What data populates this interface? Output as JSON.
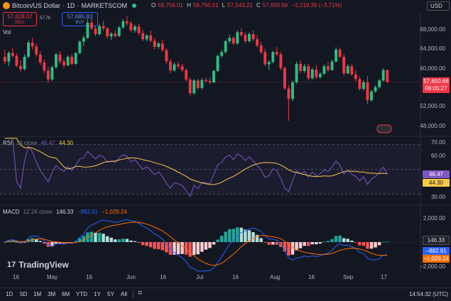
{
  "header": {
    "symbol": "Bitcoin/US Dollar",
    "interval": "1D",
    "exchange": "MARKETSCOM",
    "ohlc": [
      {
        "label": "O",
        "value": "59,756.01"
      },
      {
        "label": "H",
        "value": "59,756.01"
      },
      {
        "label": "L",
        "value": "57,543.21"
      },
      {
        "label": "C",
        "value": "57,650.66"
      }
    ],
    "change": "−2,219.39 (−3.71%)",
    "currency": "USD"
  },
  "trade": {
    "sell_price": "57,628.07",
    "sell_label": "SELL",
    "spread": "57.76",
    "buy_price": "57,685.83",
    "buy_label": "BUY"
  },
  "volume_label": "Vol",
  "price_axis": {
    "ticks": [
      "68,000.00",
      "64,000.00",
      "60,000.00",
      "56,000.00",
      "52,000.00",
      "48,000.00"
    ],
    "last_price": "57,650.66",
    "countdown": "06:05:27"
  },
  "rsi": {
    "name": "RSI",
    "params": "14 close",
    "rsi_value": "46.47",
    "ma_value": "44.30",
    "ticks": [
      "70.00",
      "60.00",
      "50.00",
      "40.00",
      "30.00"
    ]
  },
  "macd": {
    "name": "MACD",
    "params": "12 26 close",
    "hist_value": "146.33",
    "macd_value": "−882.91",
    "signal_value": "−1,029.24",
    "ticks": [
      "2,000.00",
      "0.00",
      "−2,000.00"
    ]
  },
  "time_axis": [
    "16",
    "May",
    "16",
    "Jun",
    "16",
    "Jul",
    "16",
    "Aug",
    "16",
    "Sep",
    "17"
  ],
  "timeframes": [
    "1D",
    "5D",
    "1M",
    "3M",
    "6M",
    "YTD",
    "1Y",
    "5Y",
    "All"
  ],
  "clock": "14:54:32 (UTC)",
  "brand": "TradingView",
  "colors": {
    "bg": "#131722",
    "up": "#2ebd85",
    "down": "#f23645",
    "rsi_line": "#7e57c2",
    "rsi_ma": "#f7c948",
    "macd_line": "#2962ff",
    "signal_line": "#ff6d00"
  },
  "chart_data": {
    "type": "candlestick",
    "price_range": [
      46500,
      72000
    ],
    "candles": [
      [
        63000,
        64500,
        61500,
        62000
      ],
      [
        62000,
        64200,
        61000,
        63800
      ],
      [
        63800,
        64800,
        62800,
        63200
      ],
      [
        63200,
        63700,
        60800,
        61100
      ],
      [
        61100,
        62300,
        59800,
        60400
      ],
      [
        60400,
        63500,
        60100,
        63000
      ],
      [
        63000,
        66500,
        62700,
        66000
      ],
      [
        66000,
        67000,
        64500,
        65200
      ],
      [
        65200,
        65800,
        63000,
        63500
      ],
      [
        63500,
        64200,
        61200,
        61800
      ],
      [
        61800,
        62500,
        59500,
        60100
      ],
      [
        60100,
        61000,
        57500,
        58200
      ],
      [
        58200,
        61200,
        57900,
        60800
      ],
      [
        60800,
        63800,
        60500,
        63500
      ],
      [
        63500,
        64200,
        61500,
        62000
      ],
      [
        62000,
        62600,
        60500,
        61200
      ],
      [
        61200,
        63300,
        61000,
        63000
      ],
      [
        63000,
        63600,
        61200,
        61500
      ],
      [
        61500,
        64000,
        61300,
        63800
      ],
      [
        63800,
        66500,
        63500,
        66200
      ],
      [
        66200,
        67500,
        65300,
        67000
      ],
      [
        67000,
        71000,
        66800,
        70200
      ],
      [
        70200,
        71200,
        68500,
        69000
      ],
      [
        69000,
        69600,
        67300,
        67800
      ],
      [
        67800,
        70000,
        67500,
        69500
      ],
      [
        69500,
        70600,
        68500,
        69000
      ],
      [
        69000,
        69300,
        66800,
        67300
      ],
      [
        67300,
        68200,
        66500,
        67900
      ],
      [
        67900,
        68500,
        67000,
        67400
      ],
      [
        67400,
        69500,
        67200,
        69200
      ],
      [
        69200,
        71000,
        68900,
        70500
      ],
      [
        70500,
        71600,
        69500,
        70100
      ],
      [
        70100,
        70500,
        68200,
        68600
      ],
      [
        68600,
        69800,
        68100,
        69400
      ],
      [
        69400,
        70000,
        67500,
        68000
      ],
      [
        68000,
        68700,
        66300,
        66700
      ],
      [
        66700,
        67800,
        66200,
        67500
      ],
      [
        67500,
        68500,
        66000,
        66400
      ],
      [
        66400,
        67000,
        64500,
        65100
      ],
      [
        65100,
        66100,
        64700,
        65800
      ],
      [
        65800,
        66600,
        64100,
        64400
      ],
      [
        64400,
        64800,
        61500,
        62000
      ],
      [
        62000,
        62500,
        59500,
        60100
      ],
      [
        60100,
        61800,
        59900,
        61400
      ],
      [
        61400,
        62000,
        60500,
        61000
      ],
      [
        61000,
        61500,
        59800,
        60200
      ],
      [
        60200,
        60600,
        57700,
        58200
      ],
      [
        58200,
        58700,
        54800,
        55300
      ],
      [
        55300,
        58300,
        55000,
        58000
      ],
      [
        58000,
        58400,
        56000,
        56400
      ],
      [
        56400,
        58500,
        56100,
        58100
      ],
      [
        58100,
        58600,
        57500,
        57900
      ],
      [
        57900,
        58500,
        57200,
        57600
      ],
      [
        57600,
        60300,
        57400,
        60000
      ],
      [
        60000,
        63500,
        59800,
        63200
      ],
      [
        63200,
        64500,
        62800,
        64000
      ],
      [
        64000,
        66600,
        63700,
        66300
      ],
      [
        66300,
        67700,
        65800,
        67000
      ],
      [
        67000,
        67400,
        65400,
        65800
      ],
      [
        65800,
        68600,
        65500,
        68200
      ],
      [
        68200,
        69000,
        67200,
        67600
      ],
      [
        67600,
        68200,
        65900,
        66300
      ],
      [
        66300,
        68200,
        66000,
        67800
      ],
      [
        67800,
        68600,
        66300,
        66700
      ],
      [
        66700,
        67600,
        65000,
        65400
      ],
      [
        65400,
        66200,
        63600,
        64000
      ],
      [
        64000,
        64700,
        61000,
        61400
      ],
      [
        61400,
        62300,
        60200,
        61900
      ],
      [
        61900,
        64300,
        61600,
        64000
      ],
      [
        64000,
        65100,
        63100,
        63500
      ],
      [
        63500,
        64000,
        60200,
        60600
      ],
      [
        60600,
        61000,
        56000,
        56300
      ],
      [
        56300,
        57000,
        49500,
        54100
      ],
      [
        54100,
        58000,
        53600,
        57600
      ],
      [
        57600,
        62000,
        57300,
        61500
      ],
      [
        61500,
        62300,
        59500,
        60000
      ],
      [
        60000,
        61500,
        59600,
        61000
      ],
      [
        61000,
        61500,
        58000,
        58500
      ],
      [
        58500,
        60700,
        58200,
        60300
      ],
      [
        60300,
        61300,
        58300,
        58700
      ],
      [
        58700,
        59800,
        58400,
        59400
      ],
      [
        59400,
        61400,
        59200,
        61000
      ],
      [
        61000,
        62000,
        59800,
        60200
      ],
      [
        60200,
        62400,
        60000,
        62000
      ],
      [
        62000,
        65000,
        61800,
        64500
      ],
      [
        64500,
        64900,
        62700,
        63000
      ],
      [
        63000,
        63600,
        59000,
        59500
      ],
      [
        59500,
        61400,
        59300,
        61000
      ],
      [
        61000,
        61500,
        59000,
        59300
      ],
      [
        59300,
        60200,
        57800,
        58300
      ],
      [
        58300,
        59000,
        55800,
        56200
      ],
      [
        56200,
        58000,
        55900,
        57600
      ],
      [
        57600,
        59000,
        53000,
        53800
      ],
      [
        53800,
        56000,
        53500,
        55700
      ],
      [
        55700,
        57000,
        55400,
        56600
      ],
      [
        56600,
        58300,
        56300,
        58000
      ],
      [
        58000,
        60600,
        57800,
        60200
      ],
      [
        60200,
        60300,
        57500,
        57650
      ]
    ]
  }
}
